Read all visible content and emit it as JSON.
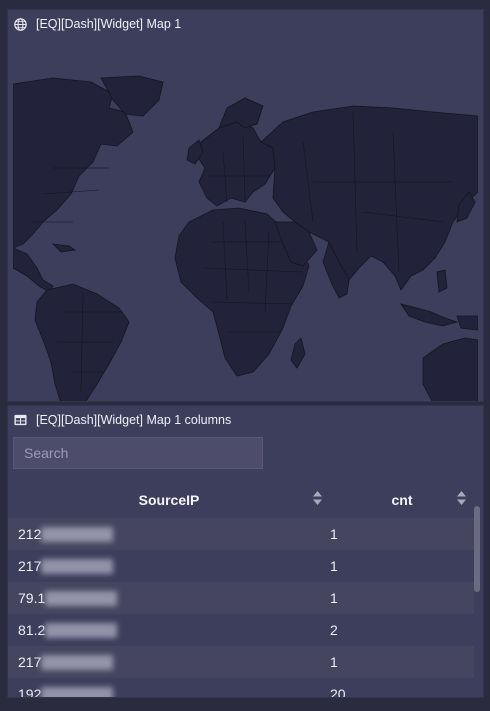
{
  "map_widget": {
    "title": "[EQ][Dash][Widget] Map 1",
    "icon": "globe-icon",
    "colors": {
      "land": "#22223a",
      "ocean": "#3d3d5c",
      "borders": "#15151f"
    }
  },
  "table_widget": {
    "title": "[EQ][Dash][Widget] Map 1 columns",
    "icon": "table-icon",
    "search_placeholder": "Search",
    "columns": [
      "SourceIP",
      "cnt"
    ],
    "rows": [
      {
        "ip": "212",
        "cnt": "1"
      },
      {
        "ip": "217",
        "cnt": "1"
      },
      {
        "ip": "79.1",
        "cnt": "1"
      },
      {
        "ip": "81.2",
        "cnt": "2"
      },
      {
        "ip": "217",
        "cnt": "1"
      },
      {
        "ip": "192",
        "cnt": "20"
      }
    ]
  }
}
